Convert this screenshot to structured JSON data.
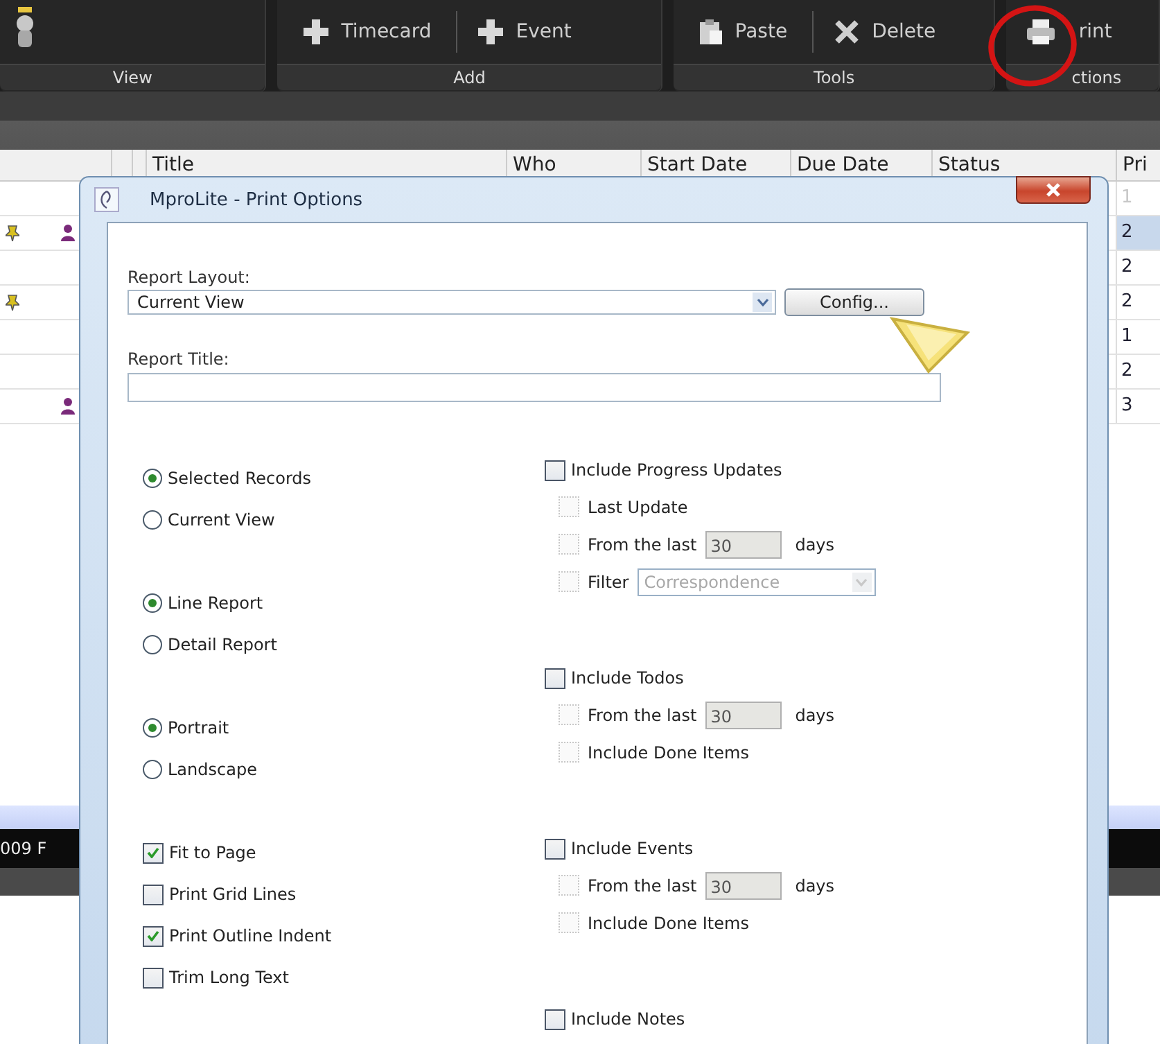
{
  "toolbar": {
    "groups": [
      {
        "label": "View",
        "buttons": [
          {
            "kind": "figure"
          }
        ]
      },
      {
        "label": "Add",
        "buttons": [
          {
            "kind": "plus",
            "label": "Timecard"
          },
          {
            "kind": "plus",
            "label": "Event"
          }
        ]
      },
      {
        "label": "Tools",
        "buttons": [
          {
            "kind": "paste",
            "label": "Paste"
          },
          {
            "kind": "delete",
            "label": "Delete"
          }
        ]
      },
      {
        "label": "ctions",
        "buttons": [
          {
            "kind": "print",
            "label": "rint"
          }
        ]
      }
    ]
  },
  "table": {
    "columns": [
      "Title",
      "Who",
      "Start Date",
      "Due Date",
      "Status",
      "Pri"
    ],
    "rows": [
      {
        "icons": [],
        "priority": "1",
        "selected": false,
        "dimmed": true
      },
      {
        "icons": [
          {
            "kind": "pin"
          },
          {
            "kind": "person"
          }
        ],
        "priority": "2",
        "selected": true,
        "dimmed": false
      },
      {
        "icons": [],
        "priority": "2",
        "selected": false,
        "dimmed": false
      },
      {
        "icons": [
          {
            "kind": "pin"
          }
        ],
        "priority": "2",
        "selected": false,
        "dimmed": false
      },
      {
        "icons": [],
        "priority": "1",
        "selected": false,
        "dimmed": false
      },
      {
        "icons": [],
        "priority": "2",
        "selected": false,
        "dimmed": false
      },
      {
        "icons": [
          {
            "kind": "person"
          }
        ],
        "priority": "3",
        "selected": false,
        "dimmed": false
      }
    ]
  },
  "status_bar": {
    "text": "009 F"
  },
  "dialog": {
    "title": "MproLite - Print Options",
    "report_layout": {
      "label": "Report Layout:",
      "value": "Current View",
      "button": "Config..."
    },
    "report_title": {
      "label": "Report Title:"
    },
    "left_groups": [
      [
        {
          "kind": "radio",
          "label": "Selected Records",
          "selected": true
        },
        {
          "kind": "radio",
          "label": "Current View",
          "selected": false
        }
      ],
      [
        {
          "kind": "radio",
          "label": "Line Report",
          "selected": true
        },
        {
          "kind": "radio",
          "label": "Detail Report",
          "selected": false
        }
      ],
      [
        {
          "kind": "radio",
          "label": "Portrait",
          "selected": true
        },
        {
          "kind": "radio",
          "label": "Landscape",
          "selected": false
        }
      ],
      [
        {
          "kind": "check",
          "label": "Fit to Page",
          "checked": true
        },
        {
          "kind": "check",
          "label": "Print Grid Lines",
          "checked": false
        },
        {
          "kind": "check",
          "label": "Print Outline Indent",
          "checked": true
        },
        {
          "kind": "check",
          "label": "Trim Long Text",
          "checked": false
        }
      ]
    ],
    "right_sections": [
      {
        "label": "Include Progress Updates",
        "checked": false,
        "options": [
          {
            "kind": "check",
            "label": "Last Update",
            "checked": false,
            "disabled": true
          },
          {
            "kind": "days",
            "label": "From the last",
            "value": "30",
            "unit": "days",
            "checked": false,
            "disabled": true
          },
          {
            "kind": "filter",
            "label": "Filter",
            "value": "Correspondence",
            "checked": false,
            "disabled": true
          }
        ]
      },
      {
        "label": "Include Todos",
        "checked": false,
        "options": [
          {
            "kind": "days",
            "label": "From the last",
            "value": "30",
            "unit": "days",
            "checked": false,
            "disabled": true
          },
          {
            "kind": "check",
            "label": "Include Done Items",
            "checked": false,
            "disabled": true
          }
        ]
      },
      {
        "label": "Include Events",
        "checked": false,
        "options": [
          {
            "kind": "days",
            "label": "From the last",
            "value": "30",
            "unit": "days",
            "checked": false,
            "disabled": true
          },
          {
            "kind": "check",
            "label": "Include Done Items",
            "checked": false,
            "disabled": true
          }
        ]
      },
      {
        "label": "Include Notes",
        "checked": false
      }
    ]
  }
}
